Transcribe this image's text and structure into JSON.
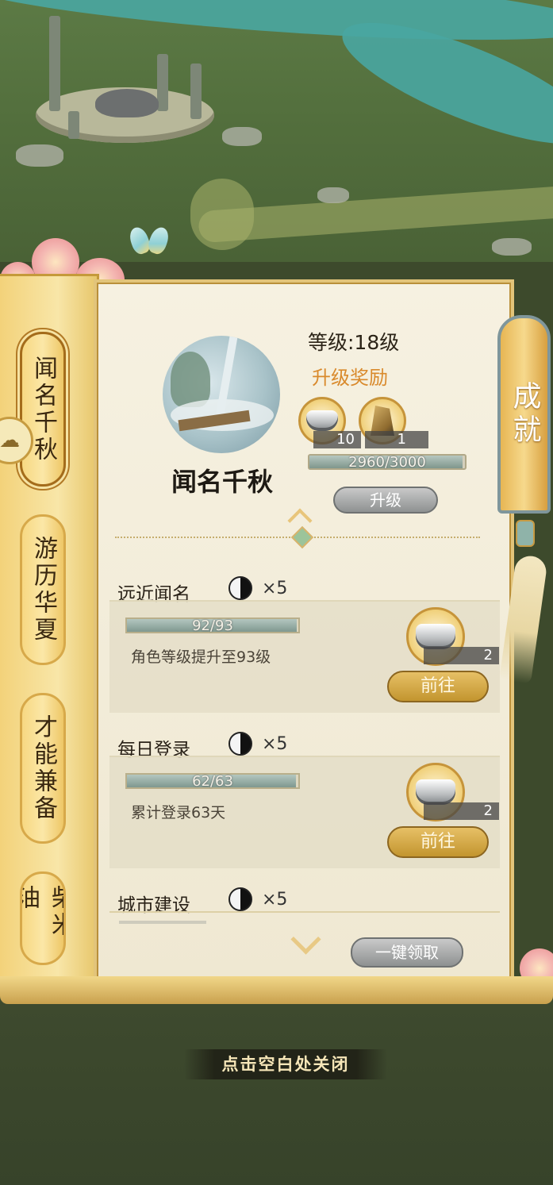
{
  "side_tabs": [
    {
      "label": "闻名千秋",
      "active": true
    },
    {
      "label": "游历华夏",
      "active": false
    },
    {
      "label": "才能兼备",
      "active": false
    },
    {
      "label": "柴米油",
      "active": false
    }
  ],
  "header": {
    "title": "闻名千秋",
    "level_text": "等级:18级",
    "upgrade_reward_label": "升级奖励",
    "rewards": [
      {
        "icon": "silver-ingot-icon",
        "qty": "10"
      },
      {
        "icon": "gold-stone-icon",
        "qty": "1"
      }
    ],
    "exp_text": "2960/3000",
    "exp_progress": 0.987,
    "upgrade_button": "升级"
  },
  "achievement_tag": "成就",
  "tasks": [
    {
      "title": "远近闻名",
      "token_icon": "yin-yang-icon",
      "multiplier": "×5",
      "progress_text": "92/93",
      "progress": 0.989,
      "description": "角色等级提升至93级",
      "reward_qty": "2",
      "button": "前往"
    },
    {
      "title": "每日登录",
      "token_icon": "yin-yang-icon",
      "multiplier": "×5",
      "progress_text": "62/63",
      "progress": 0.984,
      "description": "累计登录63天",
      "reward_qty": "2",
      "button": "前往"
    },
    {
      "title": "城市建设",
      "token_icon": "yin-yang-icon",
      "multiplier": "×5"
    }
  ],
  "collect_all_button": "一键领取",
  "close_hint": "点击空白处关闭",
  "colors": {
    "accent_gold": "#e7c066",
    "reward_orange": "#d98a2c",
    "panel_paper": "#f6f1e1"
  }
}
